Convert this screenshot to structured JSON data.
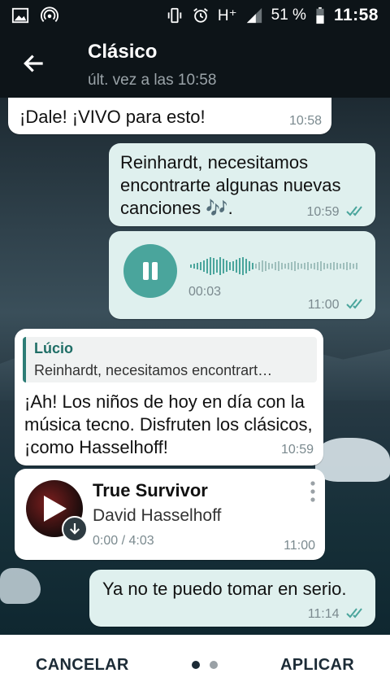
{
  "status": {
    "battery": "51 %",
    "time": "11:58",
    "network": "H⁺"
  },
  "header": {
    "title": "Clásico",
    "subtitle": "últ. vez a las 10:58"
  },
  "messages": {
    "m1": {
      "text": "¡Dale! ¡VIVO para esto!",
      "time": "10:58"
    },
    "m2": {
      "text": "Reinhardt, necesitamos encontrarte algunas nuevas canciones 🎶.",
      "time": "10:59"
    },
    "m3": {
      "duration": "00:03",
      "time": "11:00"
    },
    "m4": {
      "reply_name": "Lúcio",
      "reply_text": "Reinhardt, necesitamos encontrart…",
      "text": "¡Ah! Los niños de hoy en día con la música tecno. Disfruten los clásicos, ¡como Hasselhoff!",
      "time": "10:59"
    },
    "m5": {
      "title": "True Survivor",
      "artist": "David Hasselhoff",
      "progress": "0:00 / 4:03",
      "time": "11:00"
    },
    "m6": {
      "text": "Ya no te puedo tomar en serio.",
      "time": "11:14"
    }
  },
  "footer": {
    "cancel": "CANCELAR",
    "apply": "APLICAR",
    "page_index": 1,
    "page_count": 2
  },
  "colors": {
    "accent": "#4aa59c",
    "bar": "#0d1418",
    "out_bubble": "#dff0ee"
  }
}
